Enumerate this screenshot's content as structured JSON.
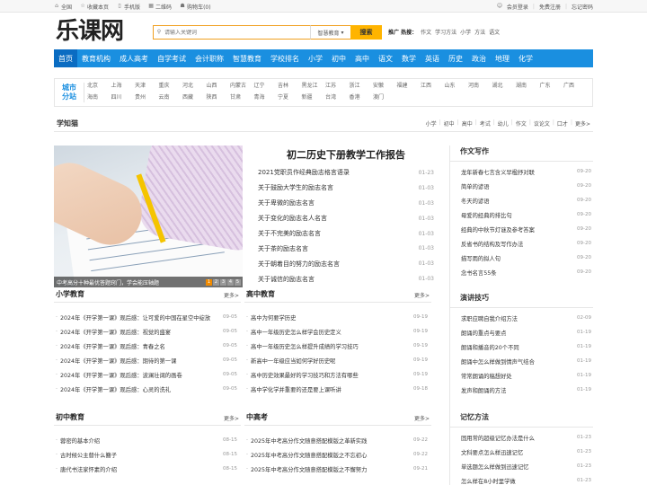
{
  "topbar": {
    "left": [
      {
        "icon": "home-icon",
        "label": "全国"
      },
      {
        "icon": "star-icon",
        "label": "收藏本页"
      },
      {
        "icon": "mobile-icon",
        "label": "手机版"
      },
      {
        "icon": "qrcode-icon",
        "label": "二维码"
      },
      {
        "icon": "cart-icon",
        "label": "购物车(0)"
      }
    ],
    "login": "会员登录",
    "register": "免费注册",
    "forgot": "忘记密码"
  },
  "header": {
    "logo": "乐课网",
    "search_placeholder": "请输入关键词",
    "search_scope": "智慧教育",
    "search_button": "搜索",
    "hot_label": "推广 热搜：",
    "hot_terms": [
      "作文",
      "学习方法",
      "小学",
      "方法",
      "语文"
    ]
  },
  "nav": [
    "首页",
    "教育机构",
    "成人高考",
    "自学考试",
    "会计职称",
    "智慧教育",
    "学校排名",
    "小学",
    "初中",
    "高中",
    "语文",
    "数学",
    "英语",
    "历史",
    "政治",
    "地理",
    "化学"
  ],
  "cities": {
    "label_line1": "城市",
    "label_line2": "分站",
    "items": [
      "北京",
      "上海",
      "天津",
      "重庆",
      "河北",
      "山西",
      "内蒙古",
      "辽宁",
      "吉林",
      "黑龙江",
      "江苏",
      "浙江",
      "安徽",
      "福建",
      "江西",
      "山东",
      "河南",
      "湖北",
      "湖南",
      "广东",
      "广西",
      "海南",
      "四川",
      "贵州",
      "云南",
      "西藏",
      "陕西",
      "甘肃",
      "青海",
      "宁夏",
      "新疆",
      "台湾",
      "香港",
      "澳门"
    ]
  },
  "xuezhimao": {
    "title": "学知猫",
    "links": [
      "小学",
      "初中",
      "高中",
      "考试",
      "幼儿",
      "作文",
      "议论文",
      "口才",
      "更多>"
    ]
  },
  "feature": {
    "caption": "中考高分十种最优答题窍门，学会能压轴题",
    "pages": [
      "1",
      "2",
      "3",
      "4",
      "5"
    ],
    "headline": "初二历史下册教学工作报告",
    "items": [
      {
        "title": "2021党职员作经典励志格言语录",
        "date": "01-23"
      },
      {
        "title": "关于鼓励大学生的励志名言",
        "date": "01-03"
      },
      {
        "title": "关于卑微的励志名言",
        "date": "01-03"
      },
      {
        "title": "关于变化的励志名人名言",
        "date": "01-03"
      },
      {
        "title": "关于不完美的励志名言",
        "date": "01-03"
      },
      {
        "title": "关于茶的励志名言",
        "date": "01-03"
      },
      {
        "title": "关于朝着目的努力的励志名言",
        "date": "01-03"
      },
      {
        "title": "关于诚信的励志名言",
        "date": "01-03"
      }
    ]
  },
  "right": [
    {
      "title": "作文写作",
      "items": [
        {
          "title": "龙年新春七言含义早楹抒对联",
          "date": "09-20"
        },
        {
          "title": "简单的谚语",
          "date": "09-20"
        },
        {
          "title": "冬天的谚语",
          "date": "09-20"
        },
        {
          "title": "母爱的经典的排比句",
          "date": "09-20"
        },
        {
          "title": "经典的中秋节灯谜及参考答案",
          "date": "09-20"
        },
        {
          "title": "反省书的结构及写作办法",
          "date": "09-20"
        },
        {
          "title": "描写雨的拟人句",
          "date": "09-20"
        },
        {
          "title": "念书名言55条",
          "date": "09-20"
        }
      ]
    },
    {
      "title": "演讲技巧",
      "items": [
        {
          "title": "求职应聘自我介绍方法",
          "date": "02-09"
        },
        {
          "title": "朗诵的重点与要点",
          "date": "01-19"
        },
        {
          "title": "朗诵和播音的20个不同",
          "date": "01-19"
        },
        {
          "title": "朗诵中怎么样做到情声气结合",
          "date": "01-19"
        },
        {
          "title": "常常朗诵的稿想好处",
          "date": "01-19"
        },
        {
          "title": "发声和朗诵的方法",
          "date": "01-19"
        }
      ]
    },
    {
      "title": "记忆方法",
      "items": [
        {
          "title": "固用常的超级记忆办法是什么",
          "date": "01-23"
        },
        {
          "title": "文科要点怎么样迅速记忆",
          "date": "01-23"
        },
        {
          "title": "单选题怎么样做到迅速记忆",
          "date": "01-23"
        },
        {
          "title": "怎么样在8小时里学做",
          "date": "01-23"
        }
      ]
    }
  ],
  "sections": [
    {
      "title": "小学教育",
      "more": "更多>",
      "items": [
        {
          "title": "2024年《开学第一课》观后感：让可爱的中国在星空中绽放",
          "date": "09-05"
        },
        {
          "title": "2024年《开学第一课》观后感：视觉的盛宴",
          "date": "09-05"
        },
        {
          "title": "2024年《开学第一课》观后感：青春之名",
          "date": "09-05"
        },
        {
          "title": "2024年《开学第一课》观后感：期待的第一课",
          "date": "09-05"
        },
        {
          "title": "2024年《开学第一课》观后感：波澜壮阔的画卷",
          "date": "09-05"
        },
        {
          "title": "2024年《开学第一课》观后感：心灵的洗礼",
          "date": "09-05"
        }
      ]
    },
    {
      "title": "高中教育",
      "more": "更多>",
      "items": [
        {
          "title": "高中为何要学历史",
          "date": "09-19"
        },
        {
          "title": "高中一年级历史怎么样学会历史定义",
          "date": "09-19"
        },
        {
          "title": "高中一年级历史怎么样提升成绩的学习技巧",
          "date": "09-19"
        },
        {
          "title": "新高中一年级应当如何学好历史呢",
          "date": "09-19"
        },
        {
          "title": "高中历史效果最好的学习技巧和方法有哪些",
          "date": "09-19"
        },
        {
          "title": "高中学化学并重要的还是要上课听讲",
          "date": "09-18"
        }
      ]
    },
    {
      "title": "初中教育",
      "more": "更多>",
      "items": [
        {
          "title": "蓉密的基本介绍",
          "date": "08-15"
        },
        {
          "title": "古时候公主替什么簪子",
          "date": "08-15"
        },
        {
          "title": "唐代书法家怀素的介绍",
          "date": "08-15"
        }
      ]
    },
    {
      "title": "中高考",
      "more": "更多>",
      "items": [
        {
          "title": "2025年中考高分作文随意搭配模版之革新实践",
          "date": "09-22"
        },
        {
          "title": "2025年中考高分作文随意搭配模版之不忘初心",
          "date": "09-22"
        },
        {
          "title": "2025年中考高分作文随意搭配模版之不懈努力",
          "date": "09-21"
        }
      ]
    }
  ]
}
